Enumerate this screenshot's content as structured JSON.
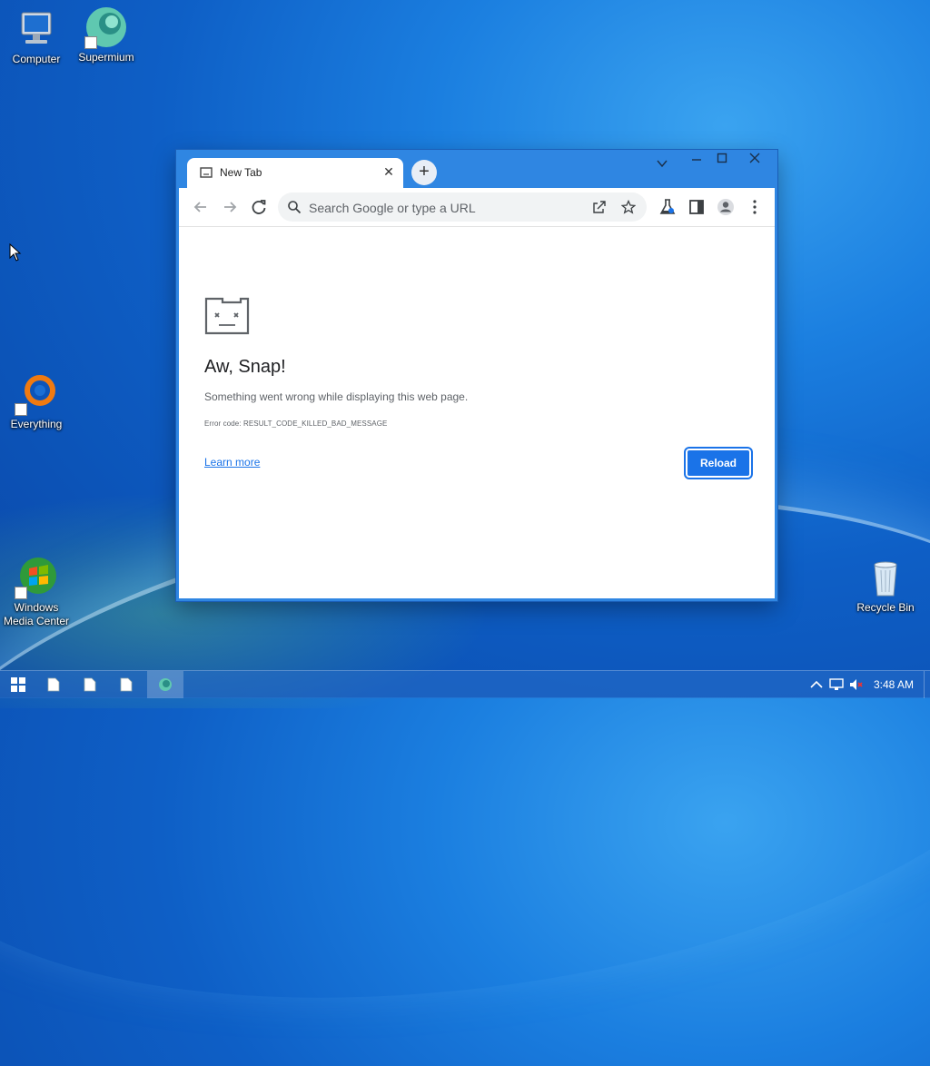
{
  "desktop": {
    "icons": [
      {
        "label": "Computer"
      },
      {
        "label": "Supermium"
      },
      {
        "label": "Everything"
      },
      {
        "label": "Windows Media Center"
      },
      {
        "label": "Recycle Bin"
      }
    ]
  },
  "browser": {
    "tab": {
      "title": "New Tab",
      "close_icon": "close-icon"
    },
    "new_tab_icon": "plus-icon",
    "window_controls": [
      "chevron-down-icon",
      "minimize-icon",
      "maximize-icon",
      "close-icon"
    ],
    "toolbar": {
      "back_icon": "arrow-left-icon",
      "forward_icon": "arrow-right-icon",
      "reload_icon": "reload-icon",
      "omnibox_placeholder": "Search Google or type a URL",
      "share_icon": "share-icon",
      "bookmark_icon": "star-icon",
      "labs_icon": "flask-icon",
      "sidepanel_icon": "side-panel-icon",
      "profile_icon": "profile-icon",
      "menu_icon": "kebab-menu-icon"
    },
    "error_page": {
      "icon": "sad-folder-icon",
      "title": "Aw, Snap!",
      "description": "Something went wrong while displaying this web page.",
      "error_code": "Error code: RESULT_CODE_KILLED_BAD_MESSAGE",
      "learn_more": "Learn more",
      "reload": "Reload"
    }
  },
  "taskbar": {
    "start_icon": "windows-logo-icon",
    "items": [
      "file-icon",
      "file-icon",
      "file-icon",
      "supermium-icon"
    ],
    "tray": [
      "chevron-up-icon",
      "network-icon",
      "volume-muted-icon"
    ],
    "clock": "3:48 AM"
  },
  "colors": {
    "accent": "#1a73e8",
    "window_frame": "#2f86e2",
    "desktop": "#0e5fc6"
  }
}
